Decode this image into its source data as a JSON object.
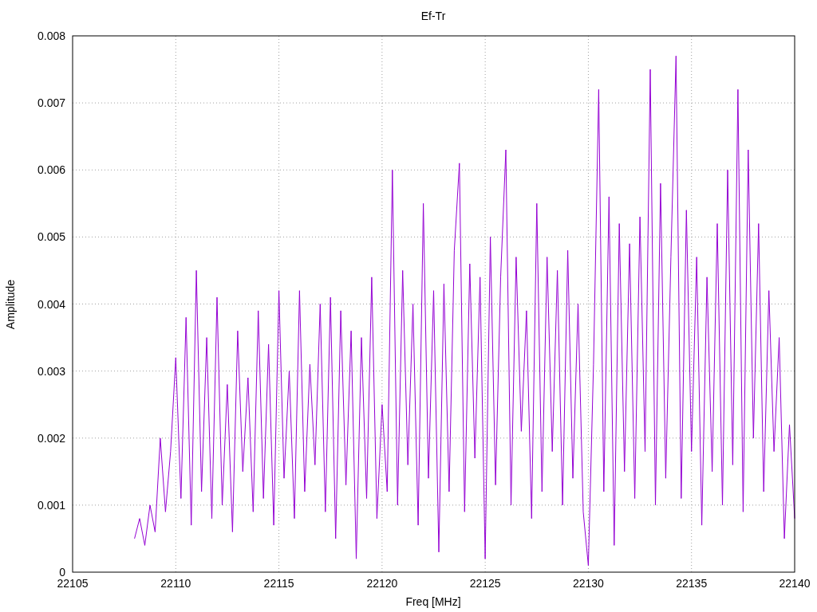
{
  "plot": {
    "chart_data": {
      "type": "line",
      "title": "Ef-Tr",
      "xlabel": "Freq [MHz]",
      "ylabel": "Amplitude",
      "grid": true,
      "xlim": [
        22105,
        22140
      ],
      "ylim": [
        0,
        0.008
      ],
      "xticks": [
        22105,
        22110,
        22115,
        22120,
        22125,
        22130,
        22135,
        22140
      ],
      "yticks": [
        0,
        0.001,
        0.002,
        0.003,
        0.004,
        0.005,
        0.006,
        0.007,
        0.008
      ],
      "x": [
        22108,
        22108.25,
        22108.5,
        22108.75,
        22109,
        22109.25,
        22109.5,
        22109.75,
        22110,
        22110.25,
        22110.5,
        22110.75,
        22111,
        22111.25,
        22111.5,
        22111.75,
        22112,
        22112.25,
        22112.5,
        22112.75,
        22113,
        22113.25,
        22113.5,
        22113.75,
        22114,
        22114.25,
        22114.5,
        22114.75,
        22115,
        22115.25,
        22115.5,
        22115.75,
        22116,
        22116.25,
        22116.5,
        22116.75,
        22117,
        22117.25,
        22117.5,
        22117.75,
        22118,
        22118.25,
        22118.5,
        22118.75,
        22119,
        22119.25,
        22119.5,
        22119.75,
        22120,
        22120.25,
        22120.5,
        22120.75,
        22121,
        22121.25,
        22121.5,
        22121.75,
        22122,
        22122.25,
        22122.5,
        22122.75,
        22123,
        22123.25,
        22123.5,
        22123.75,
        22124,
        22124.25,
        22124.5,
        22124.75,
        22125,
        22125.25,
        22125.5,
        22125.75,
        22126,
        22126.25,
        22126.5,
        22126.75,
        22127,
        22127.25,
        22127.5,
        22127.75,
        22128,
        22128.25,
        22128.5,
        22128.75,
        22129,
        22129.25,
        22129.5,
        22129.75,
        22130,
        22130.25,
        22130.5,
        22130.75,
        22131,
        22131.25,
        22131.5,
        22131.75,
        22132,
        22132.25,
        22132.5,
        22132.75,
        22133,
        22133.25,
        22133.5,
        22133.75,
        22134,
        22134.25,
        22134.5,
        22134.75,
        22135,
        22135.25,
        22135.5,
        22135.75,
        22136,
        22136.25,
        22136.5,
        22136.75,
        22137,
        22137.25,
        22137.5,
        22137.75,
        22138,
        22138.25,
        22138.5,
        22138.75,
        22139,
        22139.25,
        22139.5,
        22139.75,
        22140
      ],
      "series": [
        {
          "color": "#9400d3",
          "values": [
            0.0005,
            0.0008,
            0.0004,
            0.001,
            0.0006,
            0.002,
            0.0009,
            0.0018,
            0.0032,
            0.0011,
            0.0038,
            0.0007,
            0.0045,
            0.0012,
            0.0035,
            0.0008,
            0.0041,
            0.001,
            0.0028,
            0.0006,
            0.0036,
            0.0015,
            0.0029,
            0.0009,
            0.0039,
            0.0011,
            0.0034,
            0.0007,
            0.0042,
            0.0014,
            0.003,
            0.0008,
            0.0042,
            0.0012,
            0.0031,
            0.0016,
            0.004,
            0.0009,
            0.0041,
            0.0005,
            0.0039,
            0.0013,
            0.0036,
            0.0002,
            0.0035,
            0.0011,
            0.0044,
            0.0008,
            0.0025,
            0.0012,
            0.006,
            0.001,
            0.0045,
            0.0016,
            0.004,
            0.0007,
            0.0055,
            0.0014,
            0.0042,
            0.0003,
            0.0043,
            0.0012,
            0.0048,
            0.0061,
            0.0009,
            0.0046,
            0.0017,
            0.0044,
            0.0002,
            0.005,
            0.0013,
            0.0044,
            0.0063,
            0.001,
            0.0047,
            0.0021,
            0.0039,
            0.0008,
            0.0055,
            0.0012,
            0.0047,
            0.0018,
            0.0045,
            0.001,
            0.0048,
            0.0014,
            0.004,
            0.0009,
            0.0001,
            0.0031,
            0.0072,
            0.0012,
            0.0056,
            0.0004,
            0.0052,
            0.0015,
            0.0049,
            0.0011,
            0.0053,
            0.0018,
            0.0075,
            0.001,
            0.0058,
            0.0014,
            0.0047,
            0.0077,
            0.0011,
            0.0054,
            0.0018,
            0.0047,
            0.0007,
            0.0044,
            0.0015,
            0.0052,
            0.001,
            0.006,
            0.0016,
            0.0072,
            0.0009,
            0.0063,
            0.002,
            0.0052,
            0.0012,
            0.0042,
            0.0018,
            0.0035,
            0.0005,
            0.0022,
            0.0008
          ]
        }
      ]
    }
  }
}
